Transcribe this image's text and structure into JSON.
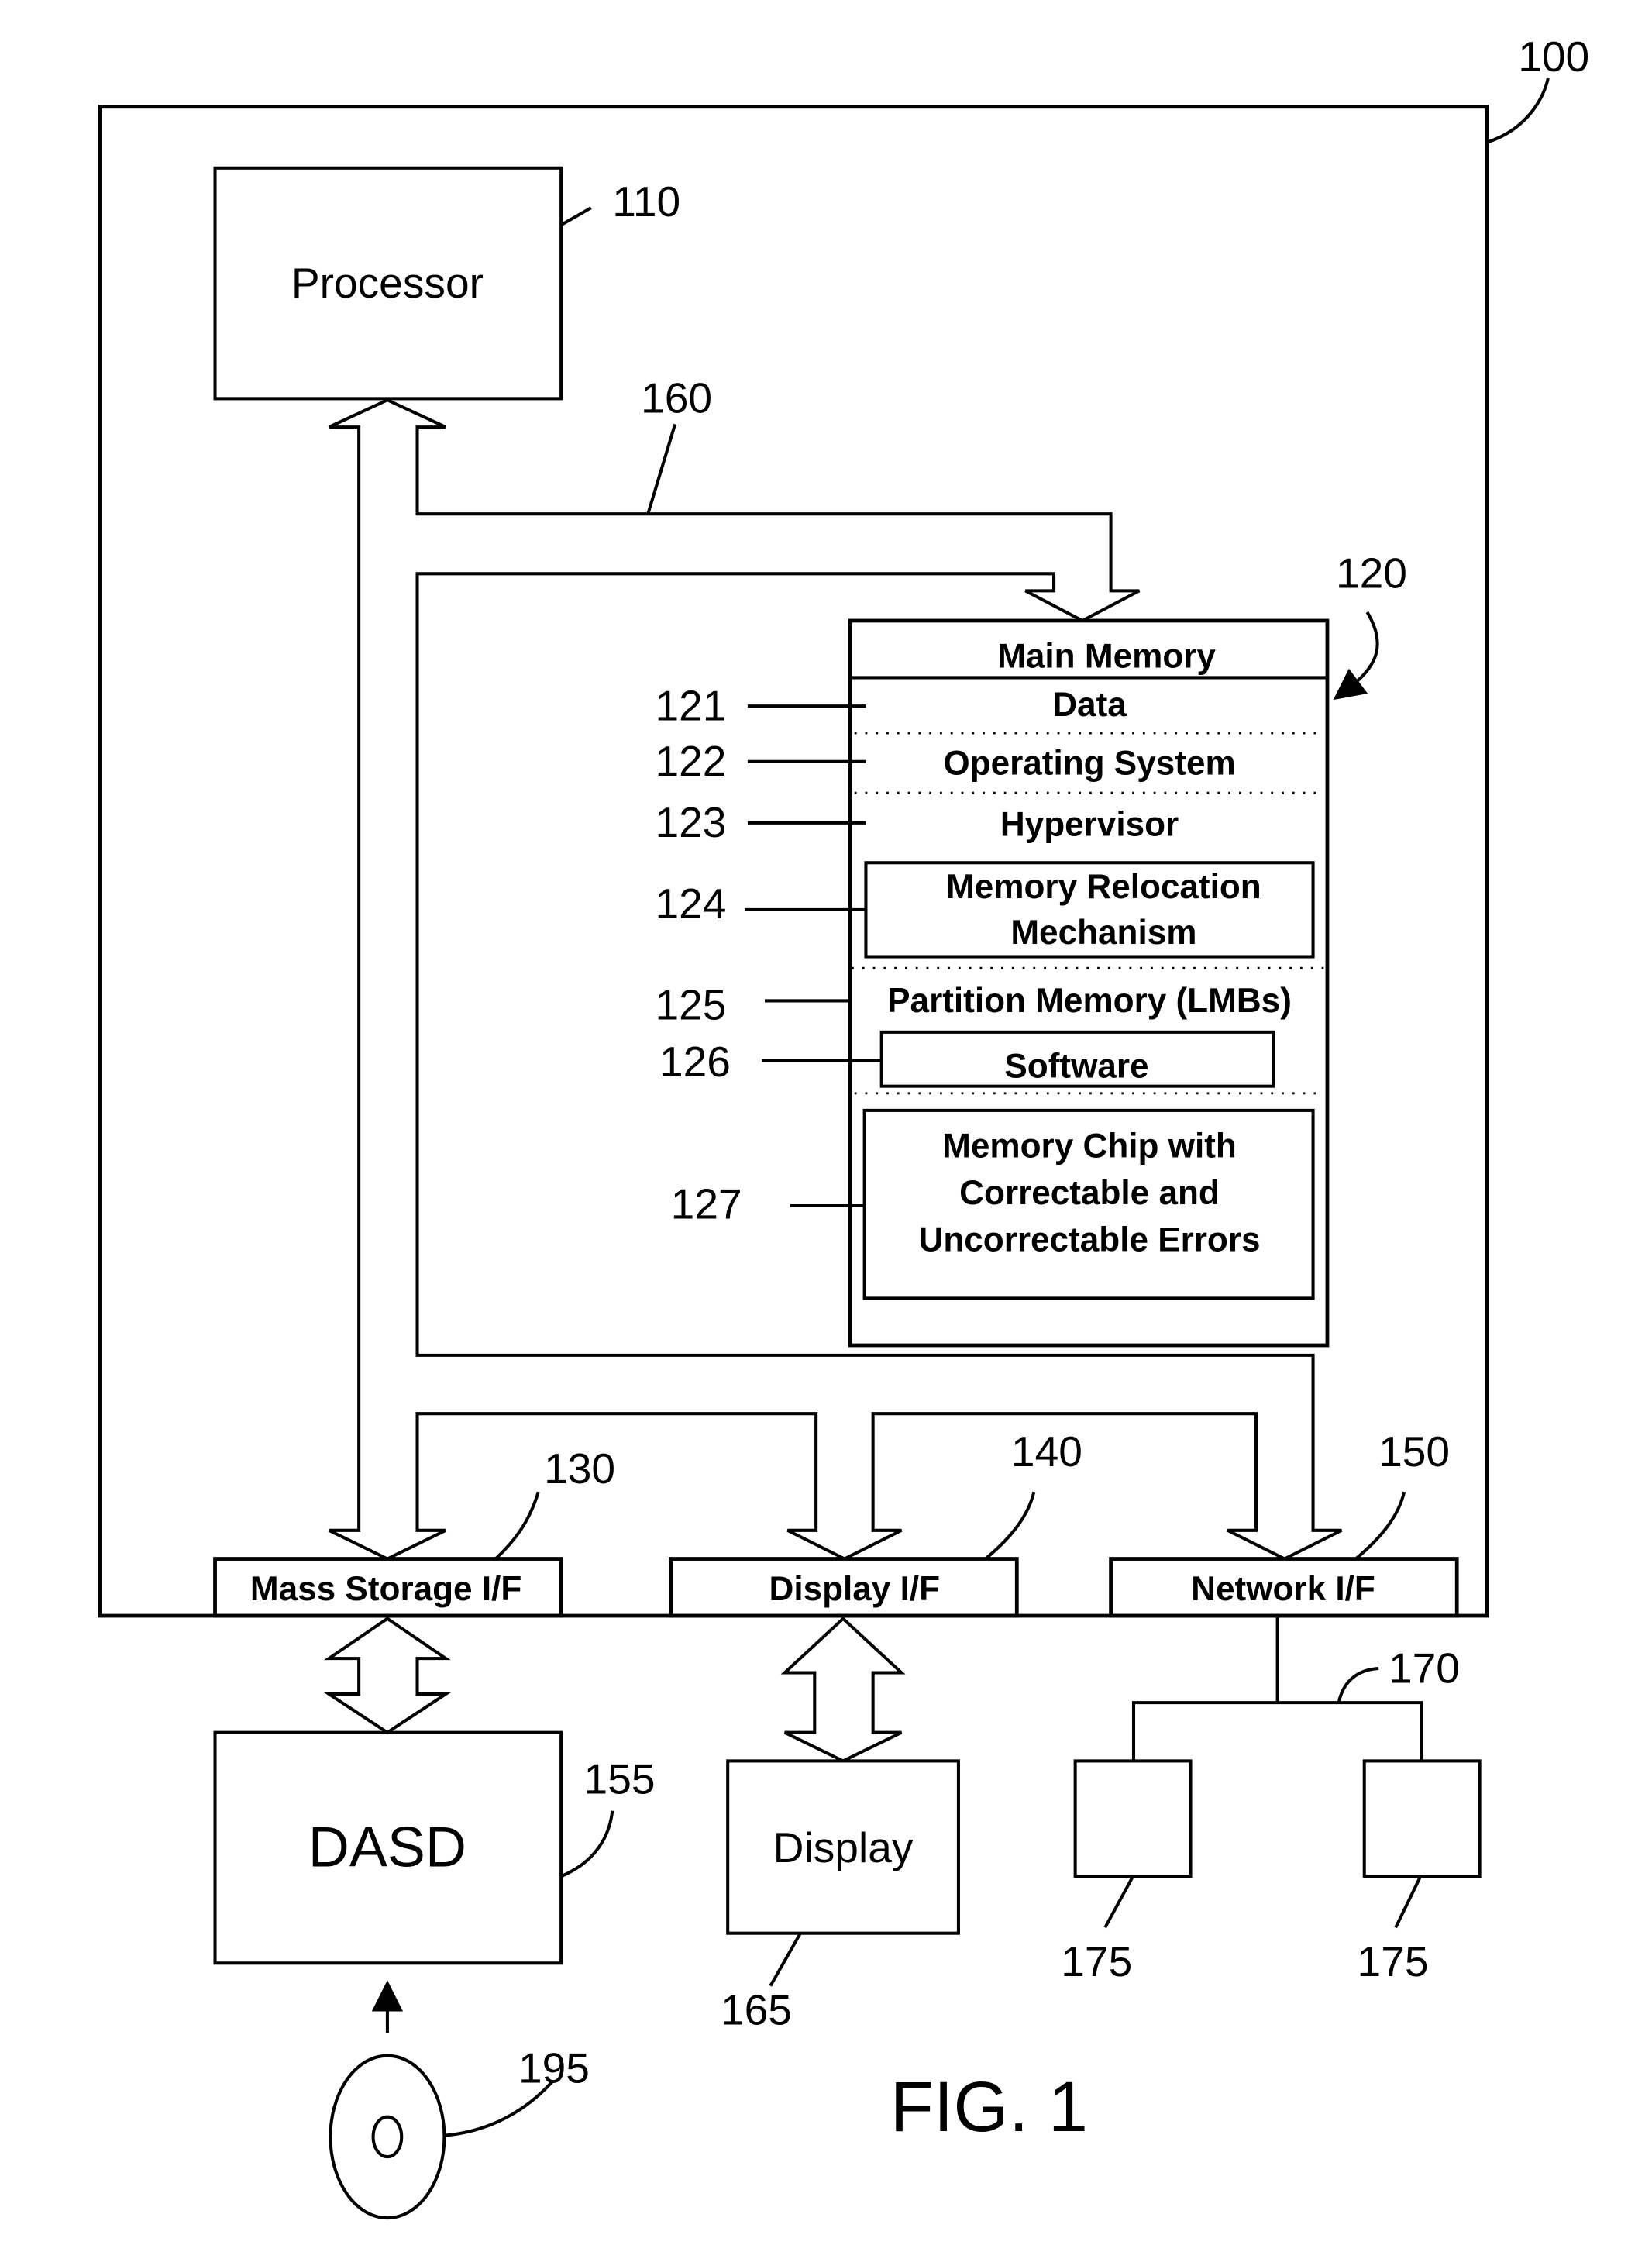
{
  "figure": {
    "caption": "FIG. 1",
    "system_ref": "100"
  },
  "processor": {
    "label": "Processor",
    "ref": "110"
  },
  "bus": {
    "ref": "160"
  },
  "main_memory": {
    "title": "Main Memory",
    "ref": "120",
    "sections": [
      {
        "ref": "121",
        "label": "Data"
      },
      {
        "ref": "122",
        "label": "Operating System"
      },
      {
        "ref": "123",
        "label": "Hypervisor"
      },
      {
        "ref": "124",
        "label_line1": "Memory Relocation",
        "label_line2": "Mechanism"
      },
      {
        "ref": "125",
        "label": "Partition Memory (LMBs)"
      },
      {
        "ref": "126",
        "label": "Software"
      },
      {
        "ref": "127",
        "label_line1": "Memory Chip with",
        "label_line2": "Correctable and",
        "label_line3": "Uncorrectable Errors"
      }
    ]
  },
  "interfaces": [
    {
      "label": "Mass Storage I/F",
      "ref": "130"
    },
    {
      "label": "Display I/F",
      "ref": "140"
    },
    {
      "label": "Network I/F",
      "ref": "150"
    }
  ],
  "dasd": {
    "label": "DASD",
    "ref": "155"
  },
  "display": {
    "label": "Display",
    "ref": "165"
  },
  "network": {
    "ref": "170"
  },
  "network_devices": [
    {
      "ref": "175"
    },
    {
      "ref": "175"
    }
  ],
  "media": {
    "ref": "195"
  }
}
